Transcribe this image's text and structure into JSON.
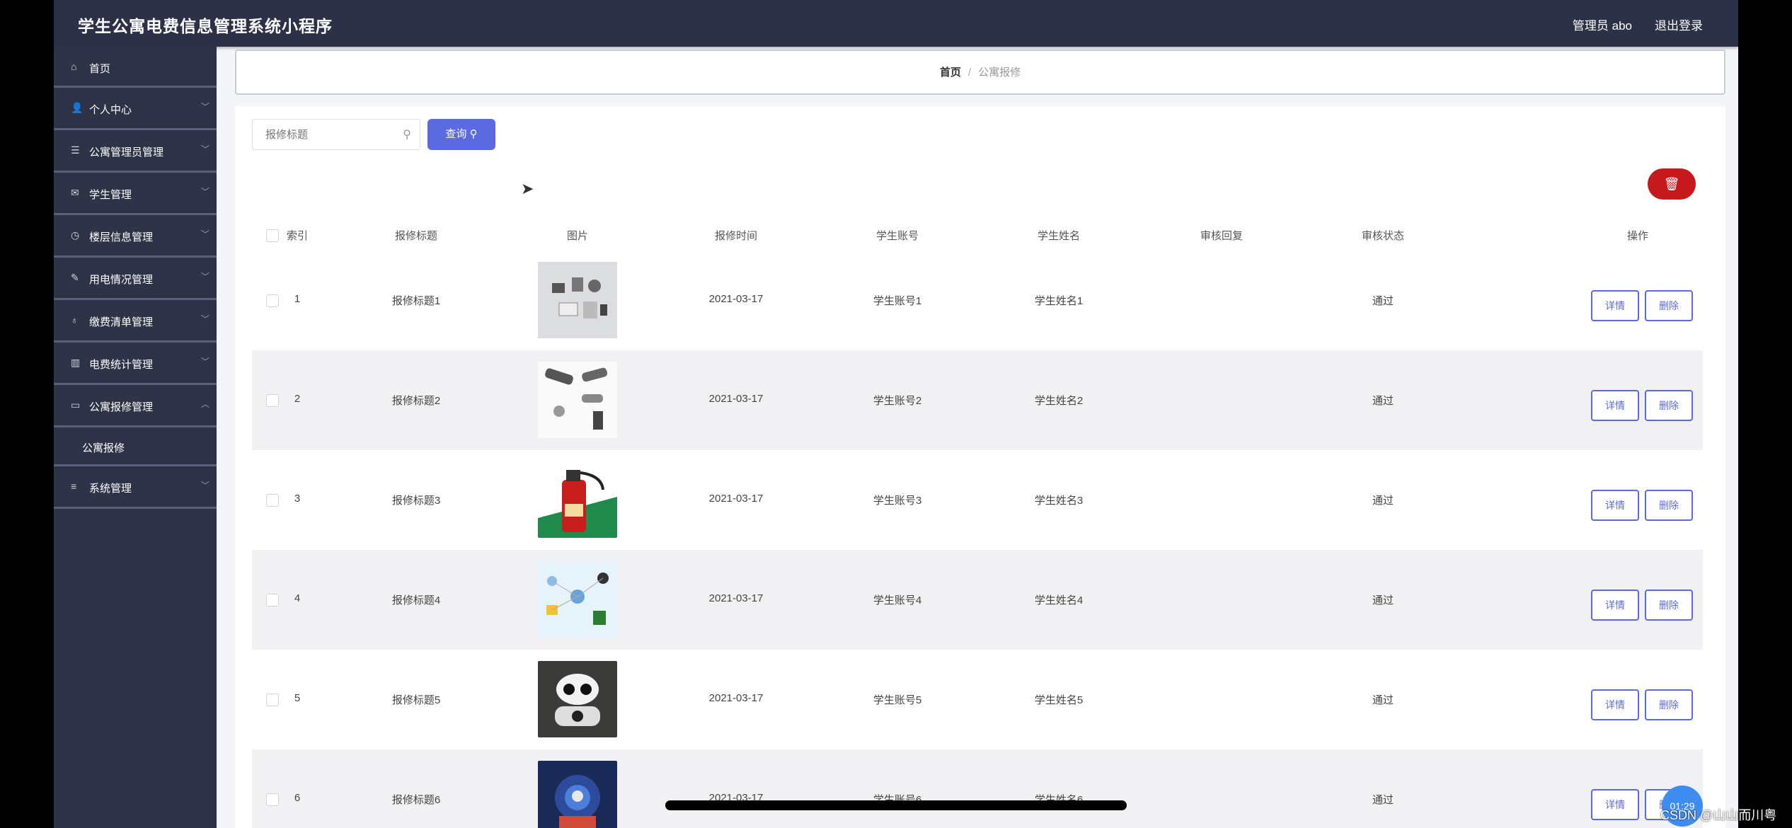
{
  "header": {
    "title": "学生公寓电费信息管理系统小程序",
    "admin": "管理员 abo",
    "logout": "退出登录"
  },
  "sidebar": {
    "items": [
      {
        "label": "首页",
        "icon": "home-icon",
        "glyph": "⌂"
      },
      {
        "label": "个人中心",
        "icon": "user-icon",
        "glyph": "👤"
      },
      {
        "label": "公寓管理员管理",
        "icon": "list-icon",
        "glyph": "☰"
      },
      {
        "label": "学生管理",
        "icon": "mail-icon",
        "glyph": "✉"
      },
      {
        "label": "楼层信息管理",
        "icon": "clock-icon",
        "glyph": "◷"
      },
      {
        "label": "用电情况管理",
        "icon": "edit-icon",
        "glyph": "✎"
      },
      {
        "label": "缴费清单管理",
        "icon": "bulb-icon",
        "glyph": "♁"
      },
      {
        "label": "电费统计管理",
        "icon": "chart-icon",
        "glyph": "▥"
      },
      {
        "label": "公寓报修管理",
        "icon": "chat-icon",
        "glyph": "▭"
      },
      {
        "label": "系统管理",
        "icon": "menu-icon",
        "glyph": "≡"
      }
    ],
    "submenu_label": "公寓报修"
  },
  "breadcrumb": {
    "home": "首页",
    "separator": "/",
    "current": "公寓报修"
  },
  "search": {
    "placeholder": "报修标题",
    "button": "查询"
  },
  "table": {
    "headers": {
      "index": "索引",
      "title": "报修标题",
      "image": "图片",
      "time": "报修时间",
      "account": "学生账号",
      "name": "学生姓名",
      "reply": "审核回复",
      "status": "审核状态",
      "action": "操作"
    },
    "actions": {
      "detail": "详情",
      "delete": "删除"
    },
    "rows": [
      {
        "index": "1",
        "title": "报修标题1",
        "time": "2021-03-17",
        "account": "学生账号1",
        "name": "学生姓名1",
        "reply": "",
        "status": "通过"
      },
      {
        "index": "2",
        "title": "报修标题2",
        "time": "2021-03-17",
        "account": "学生账号2",
        "name": "学生姓名2",
        "reply": "",
        "status": "通过"
      },
      {
        "index": "3",
        "title": "报修标题3",
        "time": "2021-03-17",
        "account": "学生账号3",
        "name": "学生姓名3",
        "reply": "",
        "status": "通过"
      },
      {
        "index": "4",
        "title": "报修标题4",
        "time": "2021-03-17",
        "account": "学生账号4",
        "name": "学生姓名4",
        "reply": "",
        "status": "通过"
      },
      {
        "index": "5",
        "title": "报修标题5",
        "time": "2021-03-17",
        "account": "学生账号5",
        "name": "学生姓名5",
        "reply": "",
        "status": "通过"
      },
      {
        "index": "6",
        "title": "报修标题6",
        "time": "2021-03-17",
        "account": "学生账号6",
        "name": "学生姓名6",
        "reply": "",
        "status": "通过"
      }
    ]
  },
  "overlay": {
    "clock": "01:29",
    "watermark": "CSDN @山山而川粤"
  },
  "colors": {
    "header_bg": "#2c3148",
    "sidebar_bg": "#2e3348",
    "accent": "#5b6ae0",
    "danger": "#c5191c"
  }
}
